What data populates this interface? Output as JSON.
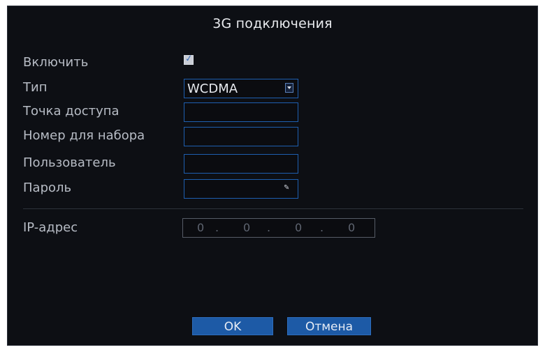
{
  "dialog": {
    "title": "3G подключения"
  },
  "form": {
    "enable_label": "Включить",
    "enable_checked": true,
    "type_label": "Тип",
    "type_value": "WCDMA",
    "apn_label": "Точка доступа",
    "apn_value": "",
    "dial_label": "Номер для набора",
    "dial_value": "",
    "user_label": "Пользователь",
    "user_value": "",
    "password_label": "Пароль",
    "password_value": "",
    "ip_label": "IP-адрес",
    "ip_octets": [
      "0",
      "0",
      "0",
      "0"
    ]
  },
  "buttons": {
    "ok": "OK",
    "cancel": "Отмена"
  },
  "colors": {
    "accent": "#1d5aa6",
    "background": "#0d0f14",
    "text": "#b7bcc5"
  }
}
